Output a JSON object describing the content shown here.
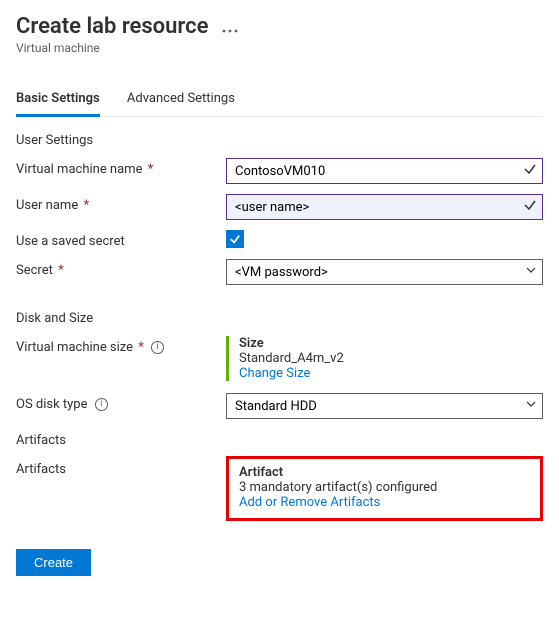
{
  "header": {
    "title": "Create lab resource",
    "subtitle": "Virtual machine"
  },
  "tabs": {
    "basic": "Basic Settings",
    "advanced": "Advanced Settings"
  },
  "sections": {
    "user_settings": "User Settings",
    "disk_size": "Disk and Size",
    "artifacts": "Artifacts"
  },
  "labels": {
    "vm_name": "Virtual machine name",
    "user_name": "User name",
    "saved_secret": "Use a saved secret",
    "secret": "Secret",
    "vm_size": "Virtual machine size",
    "os_disk": "OS disk type",
    "artifacts": "Artifacts"
  },
  "fields": {
    "vm_name": "ContosoVM010",
    "user_name": "<user name>",
    "secret_placeholder": "<VM password>",
    "os_disk": "Standard HDD"
  },
  "vm_size": {
    "heading": "Size",
    "value": "Standard_A4m_v2",
    "change": "Change Size"
  },
  "artifact_panel": {
    "heading": "Artifact",
    "status": "3 mandatory artifact(s) configured",
    "link": "Add or Remove Artifacts"
  },
  "buttons": {
    "create": "Create"
  }
}
